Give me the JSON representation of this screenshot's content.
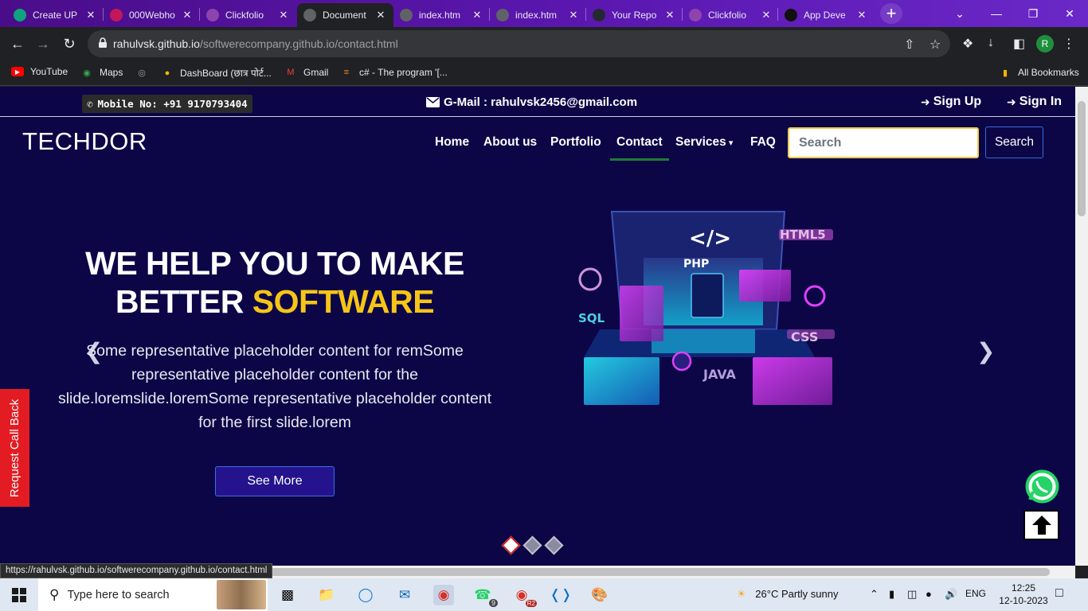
{
  "browser": {
    "tabs": [
      {
        "title": "Create UP",
        "color": "#10a37f",
        "active": false
      },
      {
        "title": "000Webho",
        "color": "#c2185b",
        "active": false
      },
      {
        "title": "Clickfolio",
        "color": "#8e44ad",
        "active": false
      },
      {
        "title": "Document",
        "color": "#5f6368",
        "active": true
      },
      {
        "title": "index.htm",
        "color": "#5f6368",
        "active": false
      },
      {
        "title": "index.htm",
        "color": "#5f6368",
        "active": false
      },
      {
        "title": "Your Repo",
        "color": "#24292f",
        "active": false
      },
      {
        "title": "Clickfolio",
        "color": "#8e44ad",
        "active": false
      },
      {
        "title": "App Deve",
        "color": "#111111",
        "active": false
      }
    ],
    "url_host": "rahulvsk.github.io",
    "url_path": "/softwerecompany.github.io/contact.html",
    "profile_initial": "R",
    "bookmarks": [
      {
        "label": "YouTube",
        "icon": "youtube-icon",
        "color": "#ff0000"
      },
      {
        "label": "Maps",
        "icon": "maps-icon",
        "color": "#34a853"
      },
      {
        "label": "",
        "icon": "globe-icon",
        "color": "#9aa0a6"
      },
      {
        "label": "DashBoard (छात्र पोर्ट...",
        "icon": "dashboard-icon",
        "color": "#f4b400"
      },
      {
        "label": "Gmail",
        "icon": "gmail-icon",
        "color": "#ea4335"
      },
      {
        "label": "c# - The program '[...",
        "icon": "stackoverflow-icon",
        "color": "#f48024"
      }
    ],
    "all_bookmarks": "All Bookmarks",
    "status_url": "https://rahulvsk.github.io/softwerecompany.github.io/contact.html"
  },
  "site": {
    "topbar": {
      "mobile": "Mobile No: +91 9170793404",
      "gmail": "G-Mail : rahulvsk2456@gmail.com",
      "signup": "Sign Up",
      "signin": "Sign In"
    },
    "brand": "TECHDOR",
    "nav": [
      "Home",
      "About us",
      "Portfolio",
      "Contact",
      "Services",
      "FAQ"
    ],
    "active_nav": "Contact",
    "search_placeholder": "Search",
    "search_button": "Search",
    "hero": {
      "title_line1": "WE HELP YOU TO MAKE",
      "title_line2_plain": "BETTER",
      "title_line2_highlight": "SOFTWARE",
      "description": "Some representative placeholder content for remSome representative placeholder content for the slide.loremslide.loremSome representative placeholder content for the first slide.lorem",
      "button": "See More",
      "art_labels": [
        "</>",
        "HTML5",
        "PHP",
        "SQL",
        "CSS",
        "JAVA"
      ]
    },
    "callback": "Request Call Back",
    "carousel_count": 3,
    "carousel_active": 0,
    "colors": {
      "background": "#0c0647",
      "highlight": "#f5c518",
      "callback": "#e31c23"
    }
  },
  "taskbar": {
    "search_placeholder": "Type here to search",
    "weather": "26°C  Partly sunny",
    "lang": "ENG",
    "time": "12:25",
    "date": "12-10-2023",
    "badges": {
      "whatsapp": "9",
      "chrome2": "R2"
    }
  }
}
